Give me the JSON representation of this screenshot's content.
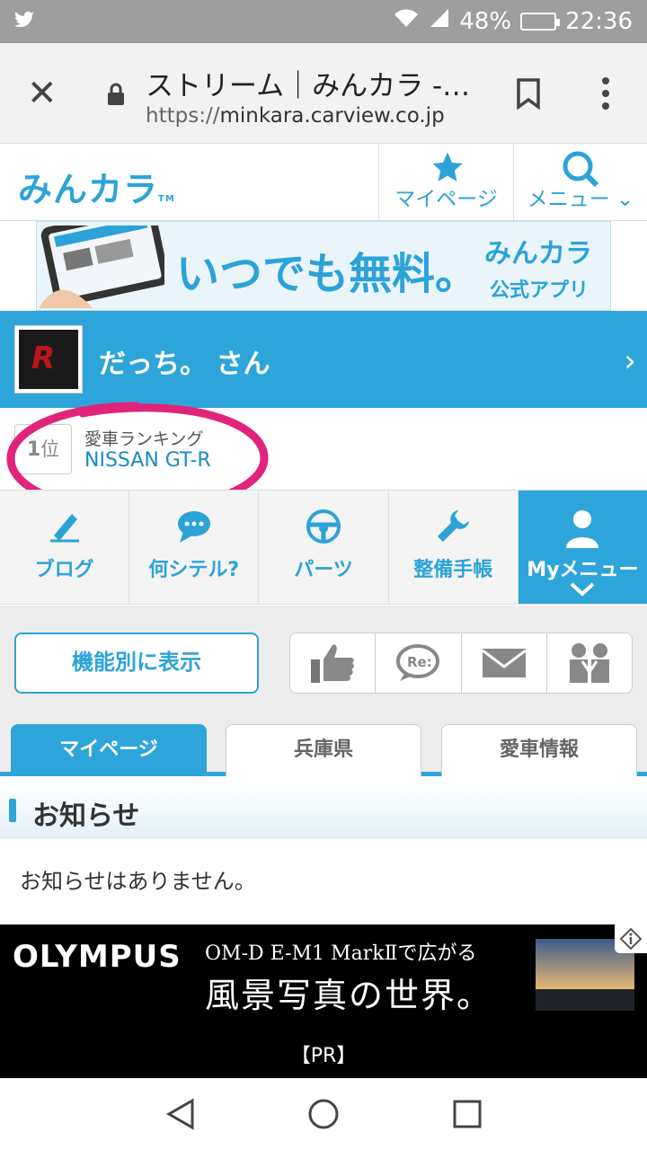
{
  "status_bar": {
    "battery": "48%",
    "time": "22:36",
    "battery_level": 0.48
  },
  "browser": {
    "title": "ストリーム｜みんカラ -…",
    "url_scheme": "https://",
    "url_host": "minkara.carview.co.jp"
  },
  "header": {
    "logo": "みんカラ",
    "logo_tm": "TM",
    "mypage_label": "マイページ",
    "menu_label": "メニュー"
  },
  "banner": {
    "slogan": "いつでも無料。",
    "app_logo": "みんカラ",
    "app_sub": "公式アプリ"
  },
  "user": {
    "name": "だっち。 さん"
  },
  "ranking": {
    "rank_num": "1",
    "rank_suffix": "位",
    "label": "愛車ランキング",
    "car": "NISSAN GT-R"
  },
  "nav_tiles": [
    {
      "label": "ブログ",
      "icon": "pencil-icon"
    },
    {
      "label": "何シテル?",
      "icon": "chat-bubble-icon"
    },
    {
      "label": "パーツ",
      "icon": "steering-wheel-icon"
    },
    {
      "label": "整備手帳",
      "icon": "wrench-icon"
    },
    {
      "label": "Myメニュー",
      "icon": "person-icon"
    }
  ],
  "function_button": "機能別に表示",
  "icon_buttons": [
    "thumbs-up-icon",
    "reply-bubble-icon",
    "mail-icon",
    "friends-icon"
  ],
  "reply_icon_text": "Re:",
  "tabs": [
    "マイページ",
    "兵庫県",
    "愛車情報"
  ],
  "active_tab": 0,
  "notice": {
    "title": "お知らせ",
    "body": "お知らせはありません。"
  },
  "ad": {
    "brand": "OLYMPUS",
    "headline": "OM-D E-M1 MarkⅡで広がる",
    "copy": "風景写真の世界。",
    "pr": "【PR】"
  },
  "colors": {
    "accent": "#2ea5da",
    "annotation": "#e0247a"
  }
}
